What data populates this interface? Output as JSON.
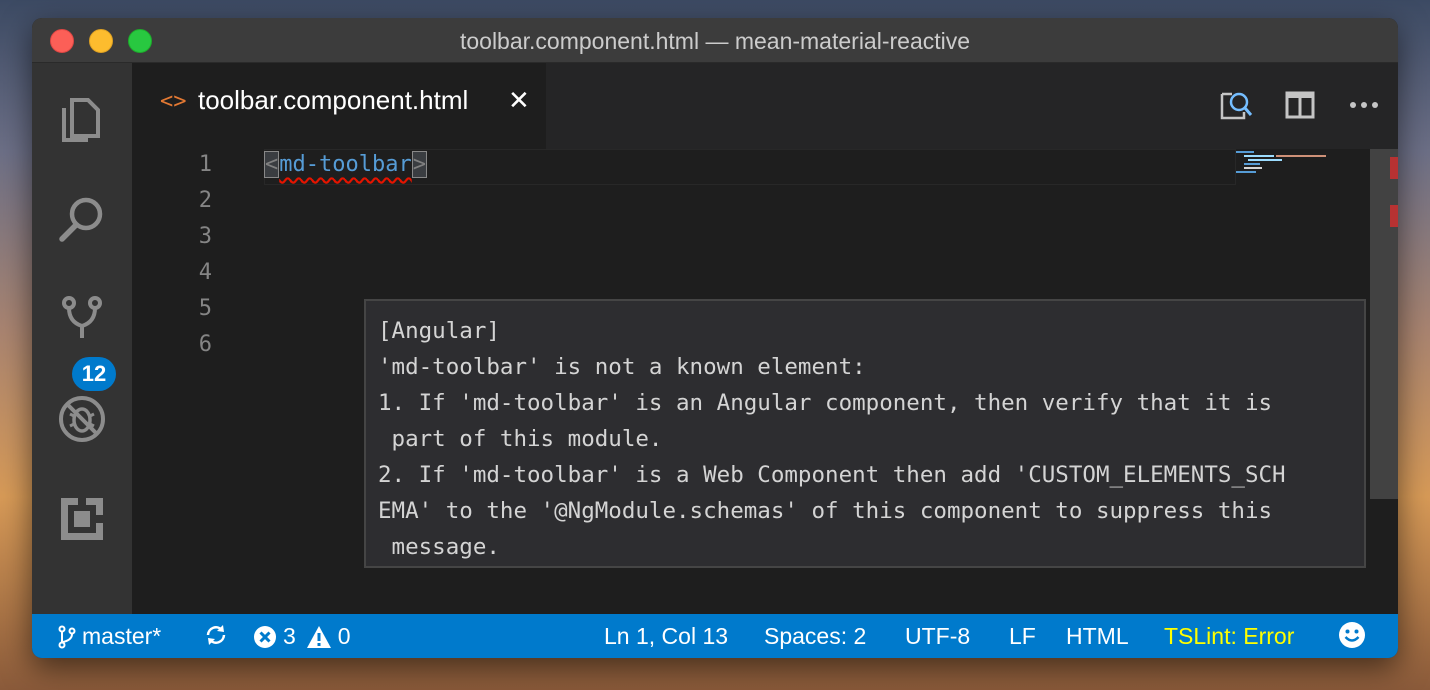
{
  "window": {
    "title": "toolbar.component.html — mean-material-reactive"
  },
  "activity_bar": {
    "items": [
      {
        "name": "explorer",
        "icon": "files-icon"
      },
      {
        "name": "search",
        "icon": "search-icon"
      },
      {
        "name": "source-control",
        "icon": "git-branch-icon",
        "badge": "12"
      },
      {
        "name": "debug",
        "icon": "no-bug-icon"
      },
      {
        "name": "extensions",
        "icon": "extensions-icon"
      }
    ]
  },
  "tabs": [
    {
      "label": "toolbar.component.html",
      "icon": "code-brackets-icon",
      "close": "✕",
      "active": true
    }
  ],
  "editor": {
    "line_numbers": [
      "1",
      "2",
      "3",
      "4",
      "5",
      "6"
    ],
    "line1": {
      "open_bracket": "<",
      "tag": "md-toolbar",
      "close_bracket": ">"
    },
    "hover": {
      "lines": [
        "[Angular]",
        "'md-toolbar' is not a known element:",
        "1. If 'md-toolbar' is an Angular component, then verify that it is",
        " part of this module.",
        "2. If 'md-toolbar' is a Web Component then add 'CUSTOM_ELEMENTS_SCH",
        "EMA' to the '@NgModule.schemas' of this component to suppress this",
        " message."
      ]
    }
  },
  "status_bar": {
    "branch": "master*",
    "errors": "3",
    "warnings": "0",
    "position": "Ln 1, Col 13",
    "spaces": "Spaces: 2",
    "encoding": "UTF-8",
    "eol": "LF",
    "language": "HTML",
    "linter": "TSLint: Error"
  },
  "colors": {
    "accent": "#007acc",
    "error": "#e51400",
    "tag": "#569cd6",
    "linter_warning": "#ffff00"
  }
}
